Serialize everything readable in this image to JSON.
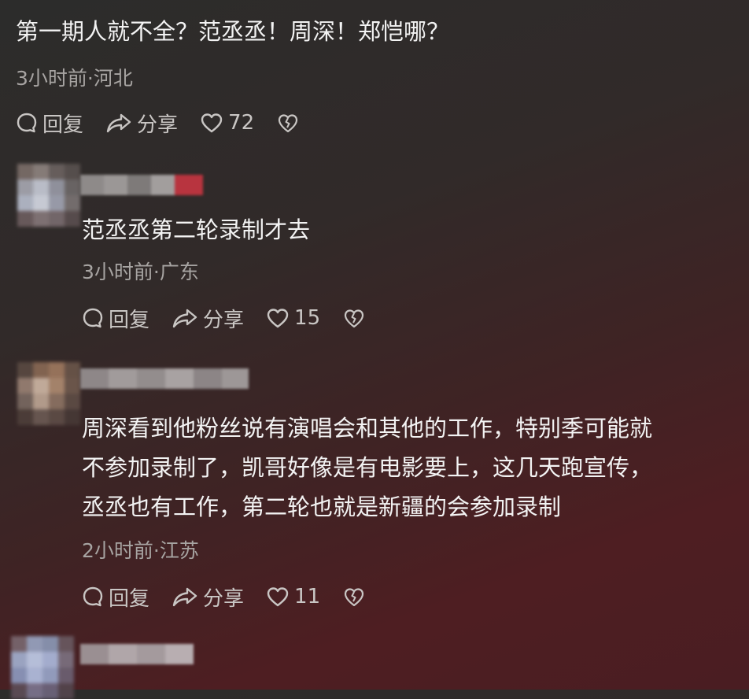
{
  "comments": [
    {
      "text": "第一期人就不全？范丞丞！周深！郑恺哪？",
      "meta": "3小时前·河北",
      "reply": "回复",
      "share": "分享",
      "likes": "72"
    },
    {
      "text": "范丞丞第二轮录制才去",
      "meta": "3小时前·广东",
      "reply": "回复",
      "share": "分享",
      "likes": "15"
    },
    {
      "text_lines": [
        "周深看到他粉丝说有演唱会和其他的工作，特别季可能就",
        "不参加录制了，凯哥好像是有电影要上，这几天跑宣传，",
        "丞丞也有工作，第二轮也就是新疆的会参加录制"
      ],
      "meta": "2小时前·江苏",
      "reply": "回复",
      "share": "分享",
      "likes": "11"
    }
  ],
  "icons": {
    "reply": "reply-bubble-icon",
    "share": "share-arrow-icon",
    "like": "heart-icon",
    "dislike": "broken-heart-icon"
  }
}
